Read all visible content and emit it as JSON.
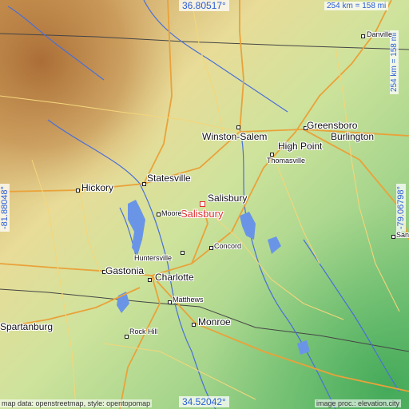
{
  "map": {
    "target": "Salisbury",
    "cities": {
      "danville": "Danville",
      "winston_salem": "Winston-Salem",
      "greensboro": "Greensboro",
      "high_point": "High Point",
      "burlington": "Burlington",
      "thomasville": "Thomasville",
      "statesville": "Statesville",
      "hickory": "Hickory",
      "salisbury": "Salisbury",
      "moore": "Moore",
      "concord": "Concord",
      "huntersville": "Huntersville",
      "gastonia": "Gastonia",
      "charlotte": "Charlotte",
      "matthews": "Matthews",
      "monroe": "Monroe",
      "spartanburg": "Spartanburg",
      "rock_hill": "Rock Hill",
      "san": "San"
    },
    "coords": {
      "top_lat": "36.80517°",
      "bottom_lat": "34.52042°",
      "left_lon": "-81.88048°",
      "right_lon": "-79.06798°"
    },
    "scale": {
      "horizontal": "254 km = 158 mi",
      "vertical": "254 km = 158 mi"
    },
    "attribution": {
      "left": "map data: openstreetmap, style: opentopomap",
      "right": "image proc.: elevation.city"
    }
  }
}
